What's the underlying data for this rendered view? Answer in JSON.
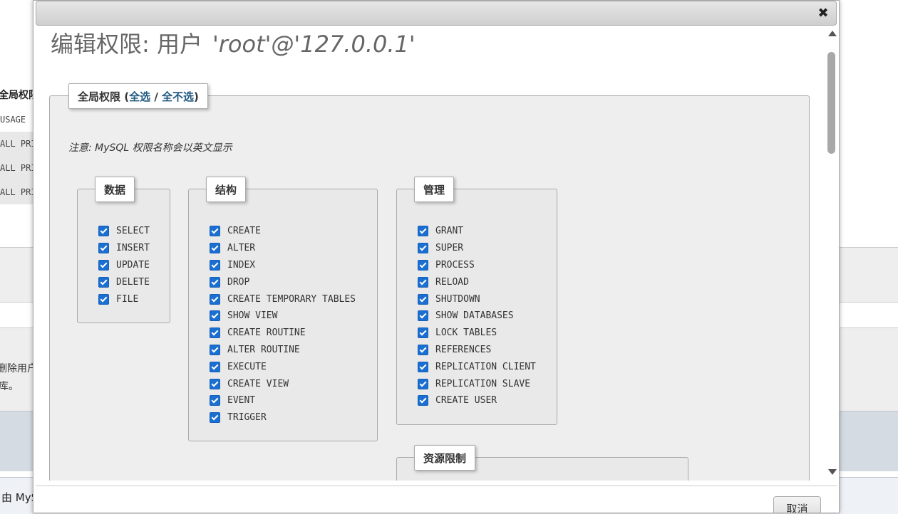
{
  "background": {
    "heading": "全局权限",
    "rows": [
      "USAGE",
      "ALL PRIVILEGES",
      "ALL PRIVILEGES",
      "ALL PRIVILEGES"
    ],
    "text_line1": "删除用户",
    "text_line2": "库。",
    "footer_text": "由 MySQL"
  },
  "dialog": {
    "title_prefix": "编辑权限: 用户",
    "title_user": "'root'@'127.0.0.1'",
    "close_icon": "✖",
    "cancel_label": "取消"
  },
  "global": {
    "legend_label": "全局权限 (",
    "select_all": "全选",
    "separator": " / ",
    "select_none": "全不选",
    "legend_close": ")",
    "note": "注意: MySQL 权限名称会以英文显示"
  },
  "groups": {
    "data": {
      "legend": "数据",
      "items": [
        "SELECT",
        "INSERT",
        "UPDATE",
        "DELETE",
        "FILE"
      ]
    },
    "structure": {
      "legend": "结构",
      "items": [
        "CREATE",
        "ALTER",
        "INDEX",
        "DROP",
        "CREATE TEMPORARY TABLES",
        "SHOW VIEW",
        "CREATE ROUTINE",
        "ALTER ROUTINE",
        "EXECUTE",
        "CREATE VIEW",
        "EVENT",
        "TRIGGER"
      ]
    },
    "admin": {
      "legend": "管理",
      "items": [
        "GRANT",
        "SUPER",
        "PROCESS",
        "RELOAD",
        "SHUTDOWN",
        "SHOW DATABASES",
        "LOCK TABLES",
        "REFERENCES",
        "REPLICATION CLIENT",
        "REPLICATION SLAVE",
        "CREATE USER"
      ]
    },
    "resources": {
      "legend": "资源限制"
    }
  },
  "colors": {
    "checkbox": "#1a6fd1",
    "link": "#235a81"
  }
}
